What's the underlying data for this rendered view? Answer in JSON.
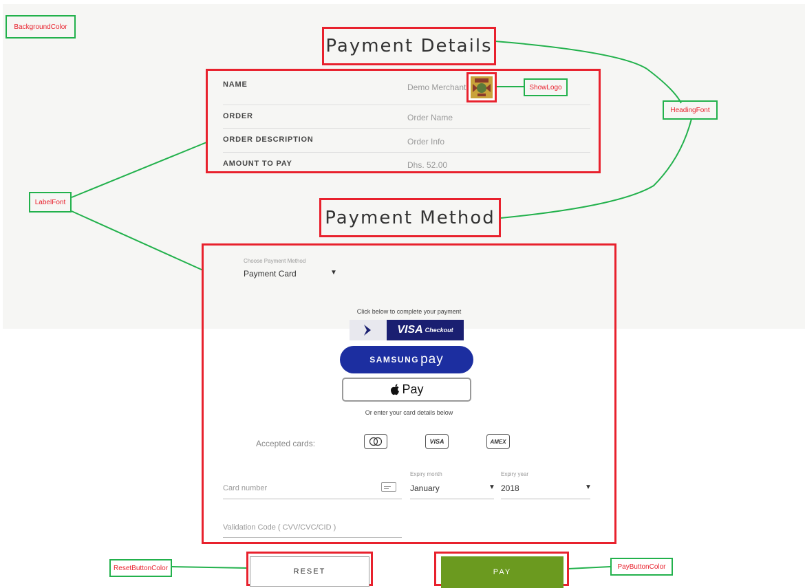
{
  "annotations": {
    "background_color": "BackgroundColor",
    "heading_font": "HeadingFont",
    "show_logo": "ShowLogo",
    "label_font": "LabelFont",
    "reset_button_color": "ResetButtonColor",
    "pay_button_color": "PayButtonColor"
  },
  "payment_details": {
    "heading": "Payment Details",
    "rows": [
      {
        "label": "NAME",
        "value": "Demo Merchant"
      },
      {
        "label": "ORDER",
        "value": "Order Name"
      },
      {
        "label": "ORDER DESCRIPTION",
        "value": "Order Info"
      },
      {
        "label": "AMOUNT TO PAY",
        "value": "Dhs. 52.00"
      }
    ]
  },
  "payment_method": {
    "heading": "Payment Method",
    "choose_label": "Choose Payment Method",
    "selected": "Payment Card",
    "click_below": "Click below to complete your payment",
    "visa_checkout": {
      "brand": "VISA",
      "suffix": "Checkout"
    },
    "samsung_pay": {
      "brand": "SAMSUNG",
      "suffix": "pay"
    },
    "apple_pay": "Pay",
    "or_enter": "Or enter your card details below",
    "accepted_cards_label": "Accepted cards:",
    "accepted_cards": [
      "mastercard-icon",
      "VISA",
      "AMEX"
    ],
    "card_number_placeholder": "Card number",
    "expiry_month_label": "Expiry month",
    "expiry_month": "January",
    "expiry_year_label": "Expiry year",
    "expiry_year": "2018",
    "cvv_placeholder": "Validation Code ( CVV/CVC/CID )"
  },
  "buttons": {
    "reset": "RESET",
    "pay": "PAY"
  },
  "colors": {
    "annotation_green": "#22b14c",
    "annotation_red": "#e8212d",
    "pay_button": "#6b9a1f",
    "visa_blue": "#1a1f71",
    "samsung_blue": "#1c2ea0"
  }
}
